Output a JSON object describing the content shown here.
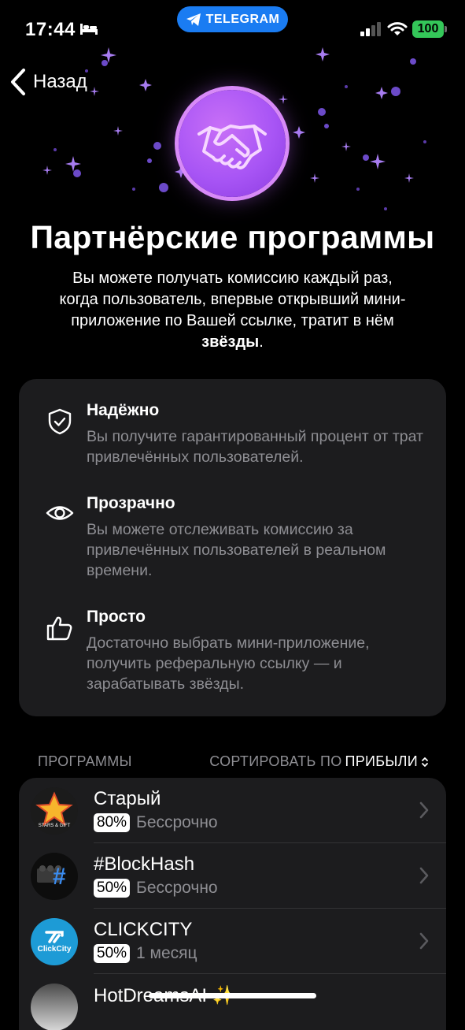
{
  "status_bar": {
    "time": "17:44",
    "pill_label": "TELEGRAM",
    "battery": "100",
    "icons": [
      "bed-icon",
      "telegram-icon",
      "signal-icon",
      "wifi-icon"
    ]
  },
  "nav": {
    "back_label": "Назад"
  },
  "hero": {
    "icon": "handshake-icon",
    "title": "Партнёрские программы",
    "subtitle_plain": "Вы можете получать комиссию каждый раз, когда пользователь, впервые открывший мини-приложение по Вашей ссылке, тратит в нём ",
    "subtitle_bold": "звёзды",
    "subtitle_end": "."
  },
  "features": [
    {
      "icon": "shield-icon",
      "title": "Надёжно",
      "desc": "Вы получите гарантированный процент от трат привлечённых пользователей."
    },
    {
      "icon": "eye-icon",
      "title": "Прозрачно",
      "desc": "Вы можете отслеживать комиссию за привлечённых пользователей в реальном времени."
    },
    {
      "icon": "thumbs-up-icon",
      "title": "Просто",
      "desc": "Достаточно выбрать мини-приложение, получить реферальную ссылку — и зарабатывать звёзды."
    }
  ],
  "programs_header": {
    "label": "ПРОГРАММЫ",
    "sort_prefix": "СОРТИРОВАТЬ ПО",
    "sort_value": "ПРИБЫЛИ"
  },
  "programs": [
    {
      "name": "Старый",
      "percent": "80%",
      "duration": "Бессрочно",
      "avatar_text": "STARS & GIFT"
    },
    {
      "name": "#BlockHash",
      "percent": "50%",
      "duration": "Бессрочно",
      "avatar_text": "#"
    },
    {
      "name": "CLICKCITY",
      "percent": "50%",
      "duration": "1 месяц",
      "avatar_text": "ClickCity"
    },
    {
      "name": "HotDreamsAI ✨",
      "percent": "",
      "duration": "",
      "avatar_text": ""
    }
  ],
  "colors": {
    "accent_blue": "#1a7cf2",
    "battery_green": "#34c759",
    "hero_purple": "#a855f5",
    "card_bg": "#1c1c1e",
    "secondary_text": "#8e8e93"
  }
}
